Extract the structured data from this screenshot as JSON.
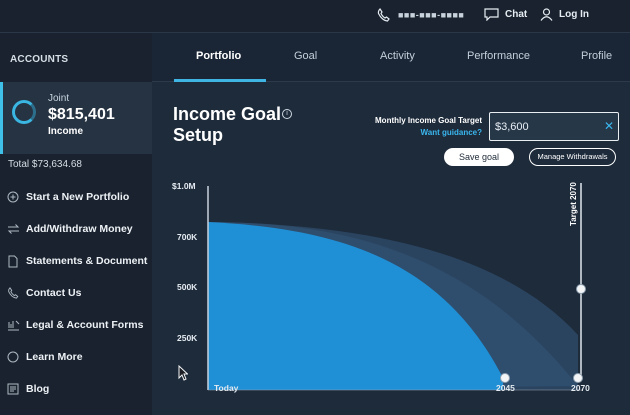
{
  "topbar": {
    "phone_number": "■■■-■■■-■■■■",
    "chat_label": "Chat",
    "login_label": "Log In"
  },
  "sidebar": {
    "header": "ACCOUNTS",
    "account": {
      "type": "Joint",
      "value": "$815,401",
      "subtitle": "Income"
    },
    "total": "Total $73,634.68",
    "nav": [
      {
        "label": "Start a New Portfolio",
        "icon": "plus-circle-icon"
      },
      {
        "label": "Add/Withdraw Money",
        "icon": "transfer-arrows-icon"
      },
      {
        "label": "Statements & Document",
        "icon": "document-icon"
      },
      {
        "label": "Contact Us",
        "icon": "phone-icon"
      },
      {
        "label": "Legal & Account Forms",
        "icon": "forms-icon"
      },
      {
        "label": "Learn More",
        "icon": "circle-icon"
      },
      {
        "label": "Blog",
        "icon": "blog-icon"
      }
    ]
  },
  "tabs": [
    "Portfolio",
    "Goal",
    "Activity",
    "Performance",
    "Profile"
  ],
  "active_tab": "Portfolio",
  "page": {
    "title": "Income Goal Setup",
    "info_icon": "i",
    "target_label": "Monthly Income Goal Target",
    "guidance_link": "Want guidance?",
    "target_value": "$3,600",
    "clear_icon": "✕",
    "save_button": "Save goal",
    "manage_button": "Manage Withdrawals"
  },
  "chart_data": {
    "type": "area",
    "y_ticks": [
      "$1.0M",
      "700K",
      "500K",
      "250K"
    ],
    "x_labels": [
      "Today",
      "2045",
      "2070"
    ],
    "target_marker_label": "Target 2070",
    "ylim": [
      0,
      1000000
    ],
    "series": [
      {
        "values": [
          {
            "x": "Today",
            "y": 810000
          },
          {
            "x": "2045",
            "y": 0
          }
        ]
      },
      {
        "values": [
          {
            "x": "Today",
            "y": 810000
          },
          {
            "x": "2070",
            "y": 0
          }
        ]
      }
    ],
    "colors": {
      "primary": "#1f8fd6",
      "secondary": "#2f4d6c",
      "tertiary": "#2a4460"
    }
  }
}
